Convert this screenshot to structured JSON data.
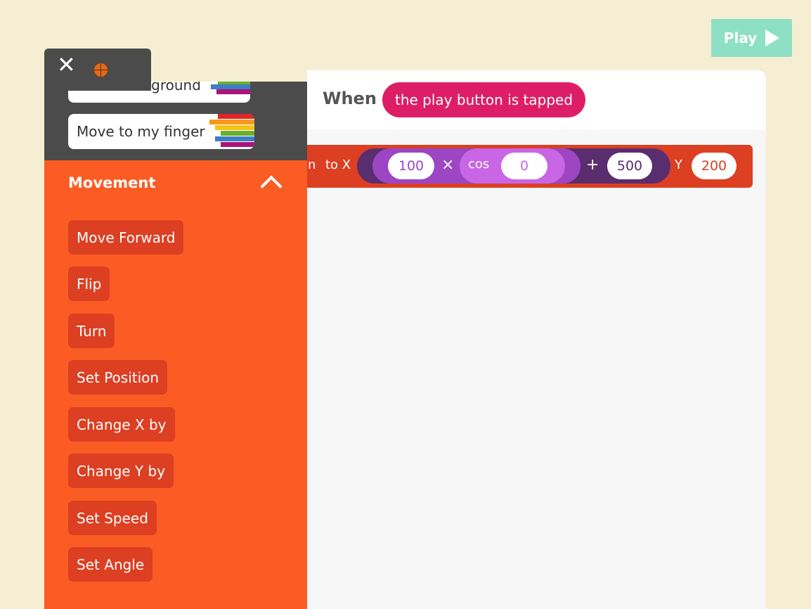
{
  "play_button": {
    "label": "Play"
  },
  "editor": {
    "when_label": "When",
    "trigger": "the play button is tapped",
    "block": {
      "partial_label": "on",
      "to_x": "to X",
      "value_multiplier": "100",
      "times_op": "×",
      "cos_label": "cos",
      "cos_value": "0",
      "plus_op": "+",
      "value_offset": "500",
      "y_label": "Y",
      "y_value": "200"
    }
  },
  "palette": {
    "top_blocks": [
      "Draw background",
      "Move to my finger"
    ],
    "section_title": "Movement",
    "commands": [
      "Move Forward",
      "Flip",
      "Turn",
      "Set Position",
      "Change X by",
      "Change Y by",
      "Set Speed",
      "Set Angle"
    ]
  },
  "colors": {
    "background": "#f6eed3",
    "play": "#8ee0c4",
    "trigger": "#dd1e66",
    "block": "#dc3f22",
    "panel_dark": "#4b4b4b",
    "panel_orange": "#fb5c24"
  },
  "icons": {
    "close": "close-icon",
    "character": "basketball-icon",
    "play": "play-triangle-icon",
    "collapse": "chevron-up-icon"
  }
}
